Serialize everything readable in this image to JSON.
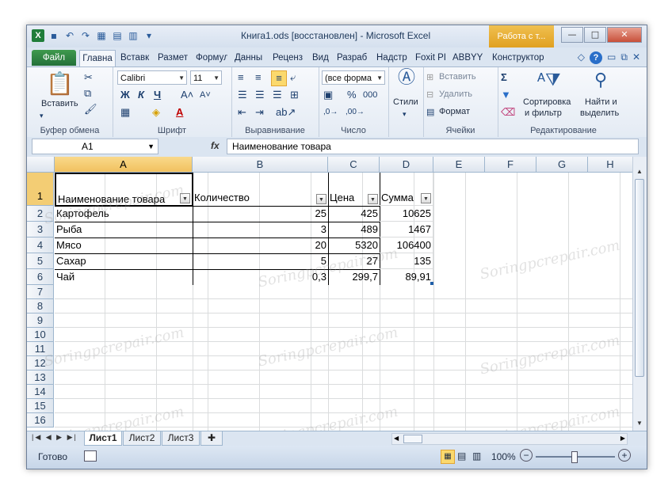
{
  "window": {
    "title": "Книга1.ods [восстановлен] - Microsoft Excel",
    "context_tab": "Работа с т..."
  },
  "ribbon_tabs": [
    "Файл",
    "Главна",
    "Вставк",
    "Размет",
    "Формул",
    "Данны",
    "Реценз",
    "Вид",
    "Разраб",
    "Надстр",
    "Foxit PI",
    "ABBYY F",
    "Конструктор"
  ],
  "ribbon": {
    "clipboard": {
      "paste": "Вставить",
      "label": "Буфер обмена"
    },
    "font": {
      "name": "Calibri",
      "size": "11",
      "label": "Шрифт"
    },
    "alignment": {
      "label": "Выравнивание"
    },
    "number": {
      "format": "(все форма",
      "label": "Число"
    },
    "styles": {
      "label": "Стили"
    },
    "cells": {
      "insert": "Вставить",
      "delete": "Удалить",
      "format": "Формат",
      "label": "Ячейки"
    },
    "editing": {
      "sort_line1": "Сортировка",
      "sort_line2": "и фильтр",
      "find_line1": "Найти и",
      "find_line2": "выделить",
      "label": "Редактирование"
    }
  },
  "formula_bar": {
    "name_box": "A1",
    "fx": "fx",
    "content": "Наименование товара"
  },
  "columns": [
    "A",
    "B",
    "C",
    "D",
    "E",
    "F",
    "G",
    "H"
  ],
  "rows": [
    "1",
    "2",
    "3",
    "4",
    "5",
    "6",
    "7",
    "8",
    "9",
    "10",
    "11",
    "12",
    "13",
    "14",
    "15",
    "16"
  ],
  "table": {
    "headers": [
      "Наименование товара",
      "Количество",
      "Цена",
      "Сумма"
    ],
    "rows": [
      [
        "Картофель",
        "25",
        "425",
        "10625"
      ],
      [
        "Рыба",
        "3",
        "489",
        "1467"
      ],
      [
        "Мясо",
        "20",
        "5320",
        "106400"
      ],
      [
        "Сахар",
        "5",
        "27",
        "135"
      ],
      [
        "Чай",
        "0,3",
        "299,7",
        "89,91"
      ]
    ]
  },
  "sheets": [
    "Лист1",
    "Лист2",
    "Лист3"
  ],
  "status": {
    "ready": "Готово",
    "zoom": "100%"
  },
  "watermark": "Soringpcrepair.com"
}
